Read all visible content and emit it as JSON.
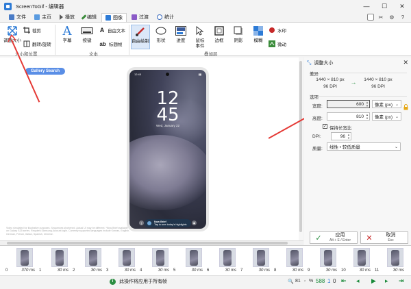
{
  "window": {
    "title": "ScreenToGif - 编辑器",
    "minimize": "—",
    "maximize": "☐",
    "close": "✕"
  },
  "menu": {
    "tabs": [
      {
        "label": "文件",
        "color": "#4a7cc7"
      },
      {
        "label": "主页",
        "color": "#5a9be0"
      },
      {
        "label": "播放",
        "color": "#555555"
      },
      {
        "label": "编辑",
        "color": "#3b8c3b"
      },
      {
        "label": "图像",
        "color": "#2d7bd6",
        "active": true
      },
      {
        "label": "过渡",
        "color": "#8a5ac7"
      },
      {
        "label": "统计",
        "color": "#3a6bbf"
      }
    ]
  },
  "ribbon": {
    "resize": "调整大小",
    "crop": "裁剪",
    "flip": "翻转/旋转",
    "group_size": "大小和位置",
    "caption": "字幕",
    "key_strokes": "按键",
    "free_text": "自由文本",
    "title_frame": "标题帧",
    "group_text": "文本",
    "free_drawing": "自由绘制",
    "shapes": "形状",
    "progress": "进度",
    "mouse_events": "鼠标\n事件",
    "border": "边框",
    "shadow": "阴影",
    "obfuscate": "模糊",
    "watermark": "水印",
    "cinemagraph": "微动",
    "group_overlay": "叠加层"
  },
  "canvas": {
    "gallery_btn": "Gallery Search",
    "phone_time_status": "12:45",
    "phone_hour": "12",
    "phone_minute": "45",
    "phone_date": "Wed, January 22",
    "notif_title": "Now Brief",
    "notif_sub": "Tap to see today's highlights",
    "fine_print": "Video simulated for illustrative purposes. Sequences shortened. Actual UI may be different. *Now Brief available on Galaxy S25 series. Requires Samsung Account login. Currently supported languages include Korean, English, German, French, Italian, Spanish, Chinese."
  },
  "panel": {
    "title": "调整大小",
    "diff_label": "差异",
    "orig_size": "1440 × 810 px",
    "orig_dpi": "96 DPI",
    "new_size": "1440 × 810 px",
    "new_dpi": "96 DPI",
    "options_label": "选项",
    "width_label": "宽度:",
    "width_value": "600",
    "height_label": "高度:",
    "height_value": "810",
    "unit_px": "像素 (px)",
    "keep_ratio": "保持长宽比",
    "dpi_label": "DPI:",
    "dpi_value": "96",
    "quality_label": "质量:",
    "quality_value": "线性 • 较低质量",
    "apply_label": "应用",
    "apply_shortcut": "Alt + E / Enter",
    "cancel_label": "取消",
    "cancel_shortcut": "Esc"
  },
  "filmstrip": {
    "frames": [
      {
        "num": "0",
        "ms": "370 ms"
      },
      {
        "num": "1",
        "ms": "30 ms"
      },
      {
        "num": "2",
        "ms": "30 ms"
      },
      {
        "num": "3",
        "ms": "30 ms"
      },
      {
        "num": "4",
        "ms": "30 ms"
      },
      {
        "num": "5",
        "ms": "30 ms"
      },
      {
        "num": "6",
        "ms": "30 ms"
      },
      {
        "num": "7",
        "ms": "30 ms"
      },
      {
        "num": "8",
        "ms": "30 ms"
      },
      {
        "num": "9",
        "ms": "30 ms"
      },
      {
        "num": "10",
        "ms": "30 ms"
      },
      {
        "num": "11",
        "ms": "30 ms"
      },
      {
        "num": "12",
        "ms": "30 ms"
      }
    ]
  },
  "status": {
    "message": "此操作将应用于所有帧",
    "zoom": "81",
    "percent": "%",
    "frame_count": "588",
    "selected": "1",
    "current": "0"
  },
  "colors": {
    "accent": "#2d7bd6",
    "arrow": "#e53935",
    "nav": "#1a8a3a"
  }
}
